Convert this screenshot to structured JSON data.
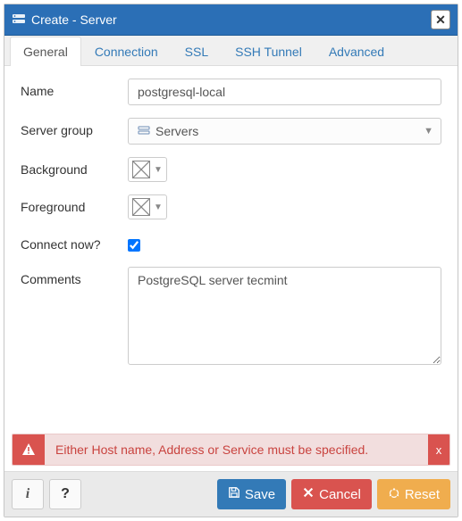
{
  "title": "Create - Server",
  "tabs": [
    "General",
    "Connection",
    "SSL",
    "SSH Tunnel",
    "Advanced"
  ],
  "activeTab": 0,
  "form": {
    "name_label": "Name",
    "name_value": "postgresql-local",
    "server_group_label": "Server group",
    "server_group_value": "Servers",
    "background_label": "Background",
    "foreground_label": "Foreground",
    "connect_now_label": "Connect now?",
    "connect_now_checked": true,
    "comments_label": "Comments",
    "comments_value": "PostgreSQL server tecmint"
  },
  "alert": {
    "text": "Either Host name, Address or Service must be specified."
  },
  "footer": {
    "save": "Save",
    "cancel": "Cancel",
    "reset": "Reset"
  }
}
